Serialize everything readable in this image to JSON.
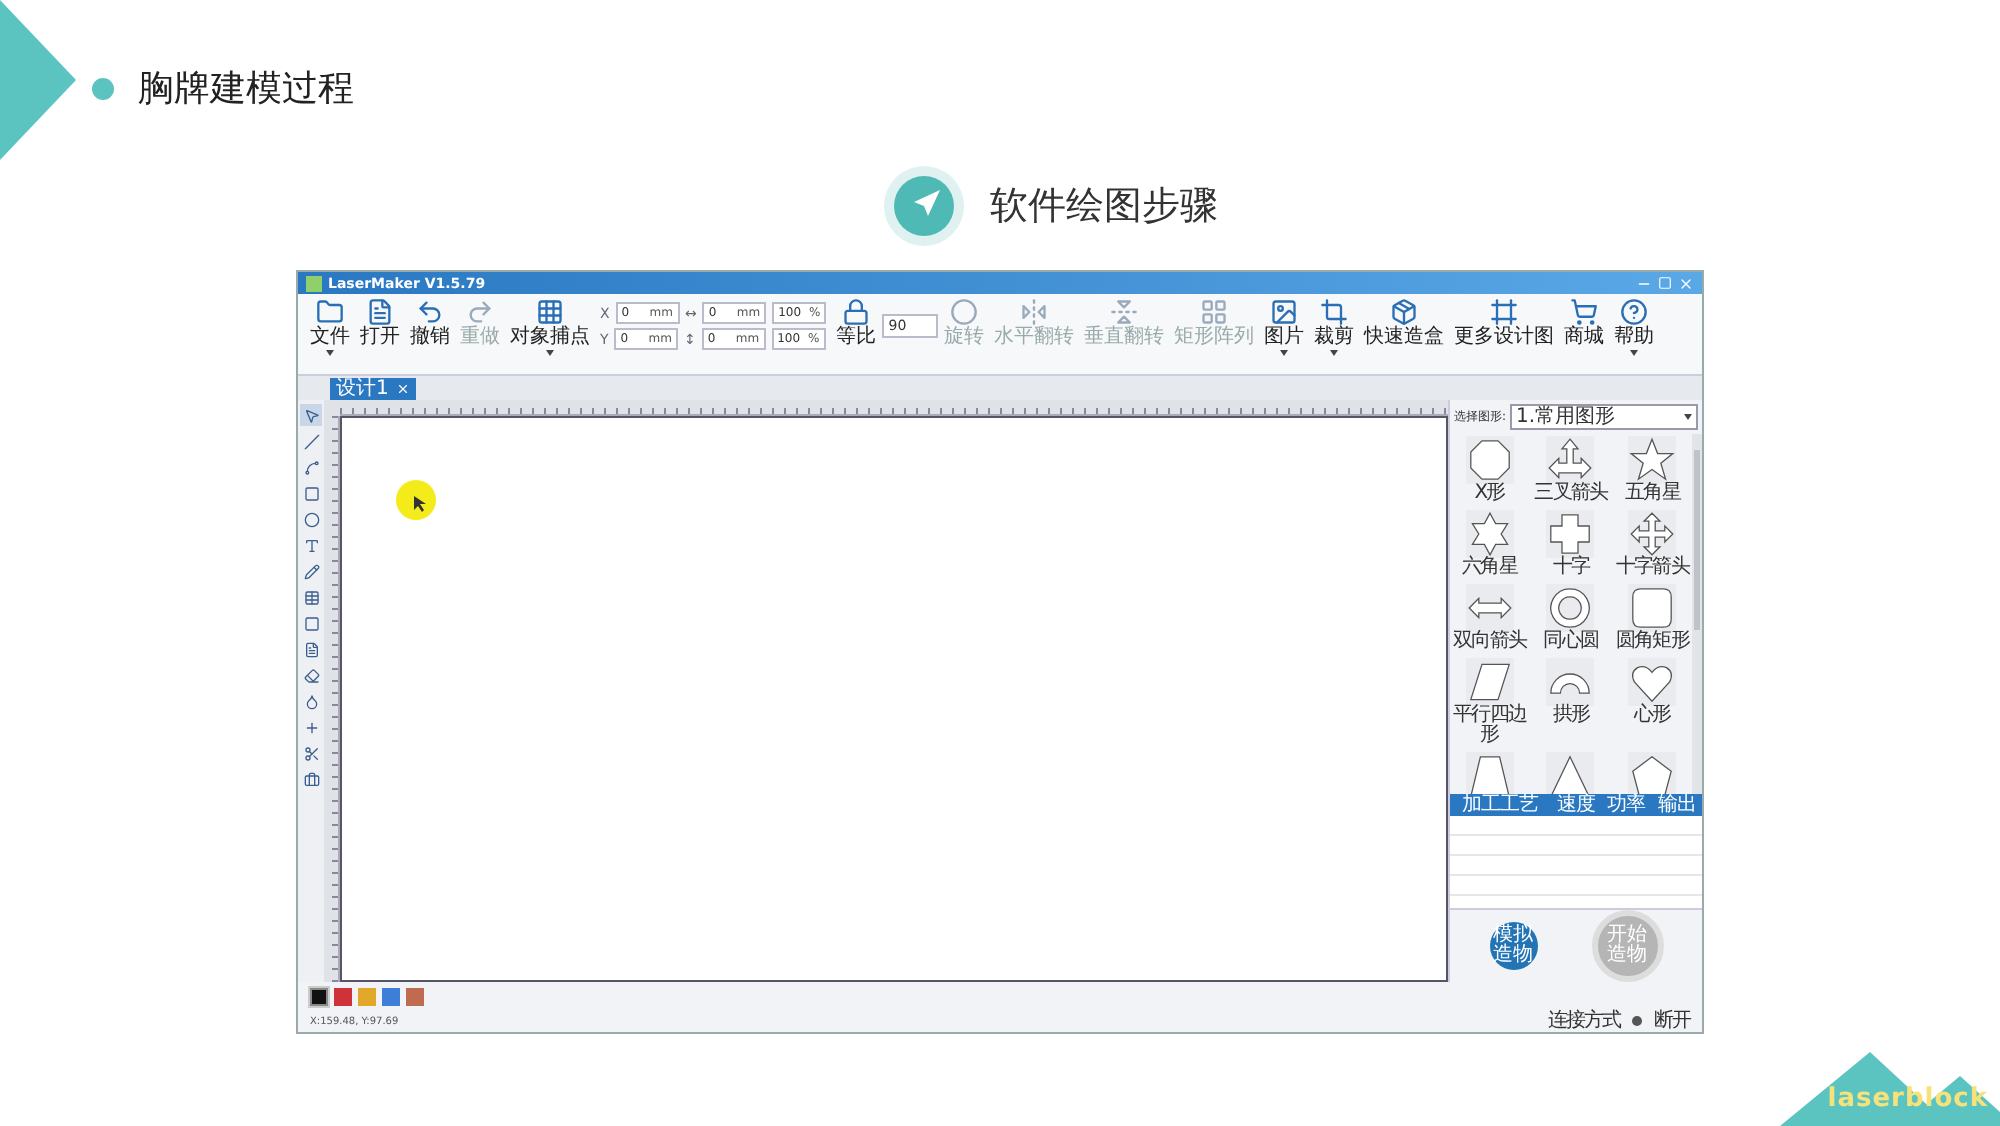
{
  "slide": {
    "title": "胸牌建模过程",
    "subtitle": "软件绘图步骤",
    "logo": "laserblock"
  },
  "app": {
    "title": "LaserMaker V1.5.79",
    "toolbar": [
      {
        "kind": "folder",
        "label": "文件",
        "dropdown": true,
        "disabled": false
      },
      {
        "kind": "file",
        "label": "打开",
        "dropdown": false,
        "disabled": false
      },
      {
        "kind": "undo",
        "label": "撤销",
        "dropdown": false,
        "disabled": false
      },
      {
        "kind": "redo",
        "label": "重做",
        "dropdown": false,
        "disabled": true
      },
      {
        "kind": "target",
        "label": "对象捕点",
        "dropdown": true,
        "disabled": false
      },
      {
        "kind": "transform",
        "rows": [
          [
            {
              "label": "X",
              "value": "0",
              "unit": "mm"
            },
            {
              "label": "↔",
              "value": "0",
              "unit": "mm"
            },
            {
              "value": "100",
              "unit": "%"
            }
          ],
          [
            {
              "label": "Y",
              "value": "0",
              "unit": "mm"
            },
            {
              "label": "↕",
              "value": "0",
              "unit": "mm"
            },
            {
              "value": "100",
              "unit": "%"
            }
          ]
        ]
      },
      {
        "kind": "lock",
        "label": "等比",
        "dropdown": false,
        "disabled": false
      },
      {
        "kind": "angle",
        "value": "90"
      },
      {
        "kind": "rotate",
        "label": "旋转",
        "dropdown": false,
        "disabled": true
      },
      {
        "kind": "flip-h",
        "label": "水平翻转",
        "dropdown": false,
        "disabled": true
      },
      {
        "kind": "flip-v",
        "label": "垂直翻转",
        "dropdown": false,
        "disabled": true
      },
      {
        "kind": "array",
        "label": "矩形阵列",
        "dropdown": false,
        "disabled": true
      },
      {
        "kind": "image",
        "label": "图片",
        "dropdown": true,
        "disabled": false
      },
      {
        "kind": "crop",
        "label": "裁剪",
        "dropdown": true,
        "disabled": false
      },
      {
        "kind": "box",
        "label": "快速造盒",
        "dropdown": false,
        "disabled": false
      },
      {
        "kind": "design",
        "label": "更多设计图",
        "dropdown": false,
        "disabled": false
      },
      {
        "kind": "cart",
        "label": "商城",
        "dropdown": false,
        "disabled": false
      },
      {
        "kind": "help",
        "label": "帮助",
        "dropdown": true,
        "disabled": false
      }
    ],
    "tabs": [
      {
        "label": "设计1",
        "selected": true
      }
    ],
    "left_tools": [
      {
        "kind": "pointer",
        "selected": true
      },
      {
        "kind": "line",
        "selected": false
      },
      {
        "kind": "curve",
        "selected": false
      },
      {
        "kind": "rect",
        "selected": false
      },
      {
        "kind": "ellipse",
        "selected": false
      },
      {
        "kind": "text",
        "selected": false
      },
      {
        "kind": "pencil",
        "selected": false
      },
      {
        "kind": "table",
        "selected": false
      },
      {
        "kind": "square",
        "selected": false
      },
      {
        "kind": "doc",
        "selected": false
      },
      {
        "kind": "eraser",
        "selected": false
      },
      {
        "kind": "drop",
        "selected": false
      },
      {
        "kind": "plus",
        "selected": false
      },
      {
        "kind": "scissors",
        "selected": false
      },
      {
        "kind": "case",
        "selected": false
      }
    ],
    "shape_picker": {
      "label": "选择图形:",
      "value": "1.常用图形"
    },
    "shapes": [
      {
        "kind": "x",
        "label": "X形"
      },
      {
        "kind": "tri-arrow",
        "label": "三叉箭头"
      },
      {
        "kind": "star5",
        "label": "五角星"
      },
      {
        "kind": "star6",
        "label": "六角星"
      },
      {
        "kind": "cross",
        "label": "十字"
      },
      {
        "kind": "cross-arrow",
        "label": "十字箭头"
      },
      {
        "kind": "double-arrow",
        "label": "双向箭头"
      },
      {
        "kind": "rings",
        "label": "同心圆"
      },
      {
        "kind": "rounded-rect",
        "label": "圆角矩形"
      },
      {
        "kind": "parallelogram",
        "label": "平行四边形"
      },
      {
        "kind": "arch",
        "label": "拱形"
      },
      {
        "kind": "heart",
        "label": "心形"
      },
      {
        "kind": "trapezoid"
      },
      {
        "kind": "triangle"
      },
      {
        "kind": "pentagon"
      }
    ],
    "process_table": {
      "columns": [
        "加工工艺",
        "速度",
        "功率",
        "输出"
      ]
    },
    "actions": [
      {
        "kind": "simulate",
        "label": "模拟造物"
      },
      {
        "kind": "start",
        "label": "开始造物"
      }
    ],
    "palette": [
      {
        "color": "#111111",
        "selected": true
      },
      {
        "color": "#d0323a",
        "selected": false
      },
      {
        "color": "#e2a82a",
        "selected": false
      },
      {
        "color": "#3d7fd8",
        "selected": false
      },
      {
        "color": "#c06a50",
        "selected": false
      }
    ],
    "coordinates": "X:159.48, Y:97.69",
    "status": {
      "connection": "连接方式",
      "state": "断开"
    }
  }
}
